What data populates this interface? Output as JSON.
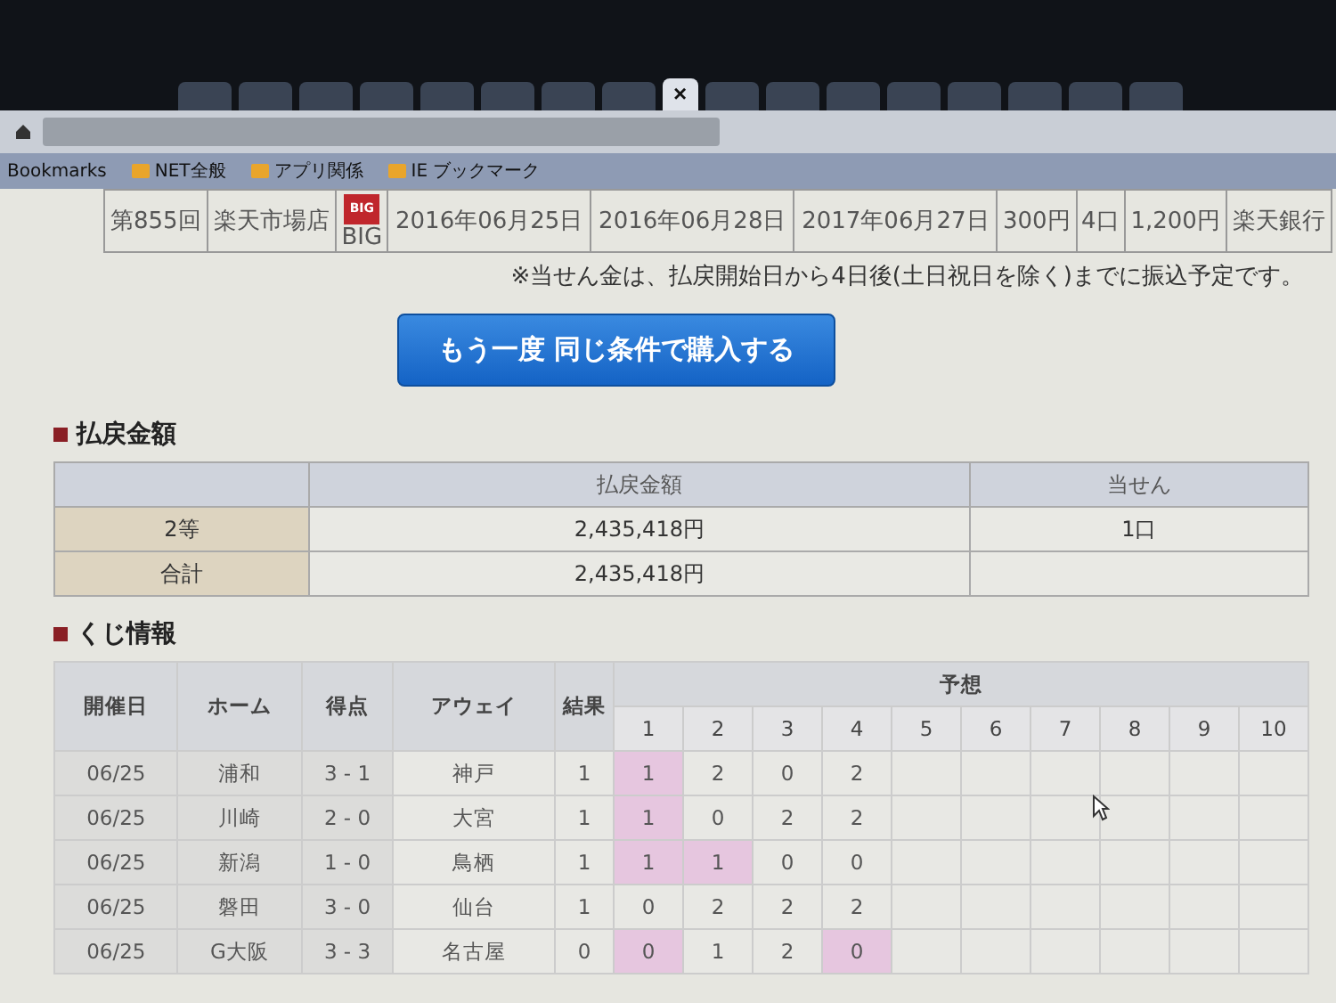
{
  "browser": {
    "tab_close": "×",
    "bookmarks": [
      {
        "label": "Bookmarks",
        "kind": "text"
      },
      {
        "label": "NET全般",
        "kind": "folder"
      },
      {
        "label": "アプリ関係",
        "kind": "folder"
      },
      {
        "label": "IE ブックマーク",
        "kind": "folder"
      }
    ]
  },
  "purchase_row": [
    "第855回",
    "楽天市場店",
    "BIG",
    "2016年06月25日",
    "2016年06月28日",
    "2017年06月27日",
    "300円",
    "4口",
    "1,200円",
    "楽天銀行"
  ],
  "purchase_logo": "BIG",
  "note": "※当せん金は、払戻開始日から4日後(土日祝日を除く)までに振込予定です。",
  "rebuy_button": "もう一度 同じ条件で購入する",
  "payout": {
    "title": "払戻金額",
    "columns": [
      "払戻金額",
      "当せん"
    ],
    "rows": [
      {
        "label": "2等",
        "amount": "2,435,418円",
        "count": "1口"
      },
      {
        "label": "合計",
        "amount": "2,435,418円"
      }
    ]
  },
  "kuji": {
    "title": "くじ情報",
    "columns": [
      "開催日",
      "ホーム",
      "得点",
      "アウェイ",
      "結果"
    ],
    "prediction_header": "予想",
    "prediction_columns": [
      "1",
      "2",
      "3",
      "4",
      "5",
      "6",
      "7",
      "8",
      "9",
      "10"
    ],
    "rows": [
      {
        "date": "06/25",
        "home": "浦和",
        "score": "3 - 1",
        "away": "神戸",
        "result": "1",
        "picks": [
          {
            "value": "1",
            "hit": true
          },
          {
            "value": "2",
            "hit": false
          },
          {
            "value": "0",
            "hit": false
          },
          {
            "value": "2",
            "hit": false
          }
        ]
      },
      {
        "date": "06/25",
        "home": "川崎",
        "score": "2 - 0",
        "away": "大宮",
        "result": "1",
        "picks": [
          {
            "value": "1",
            "hit": true
          },
          {
            "value": "0",
            "hit": false
          },
          {
            "value": "2",
            "hit": false
          },
          {
            "value": "2",
            "hit": false
          }
        ]
      },
      {
        "date": "06/25",
        "home": "新潟",
        "score": "1 - 0",
        "away": "鳥栖",
        "result": "1",
        "picks": [
          {
            "value": "1",
            "hit": true
          },
          {
            "value": "1",
            "hit": true
          },
          {
            "value": "0",
            "hit": false
          },
          {
            "value": "0",
            "hit": false
          }
        ]
      },
      {
        "date": "06/25",
        "home": "磐田",
        "score": "3 - 0",
        "away": "仙台",
        "result": "1",
        "picks": [
          {
            "value": "0",
            "hit": false
          },
          {
            "value": "2",
            "hit": false
          },
          {
            "value": "2",
            "hit": false
          },
          {
            "value": "2",
            "hit": false
          }
        ]
      },
      {
        "date": "06/25",
        "home": "G大阪",
        "score": "3 - 3",
        "away": "名古屋",
        "result": "0",
        "picks": [
          {
            "value": "0",
            "hit": true
          },
          {
            "value": "1",
            "hit": false
          },
          {
            "value": "2",
            "hit": false
          },
          {
            "value": "0",
            "hit": true
          }
        ]
      }
    ]
  }
}
